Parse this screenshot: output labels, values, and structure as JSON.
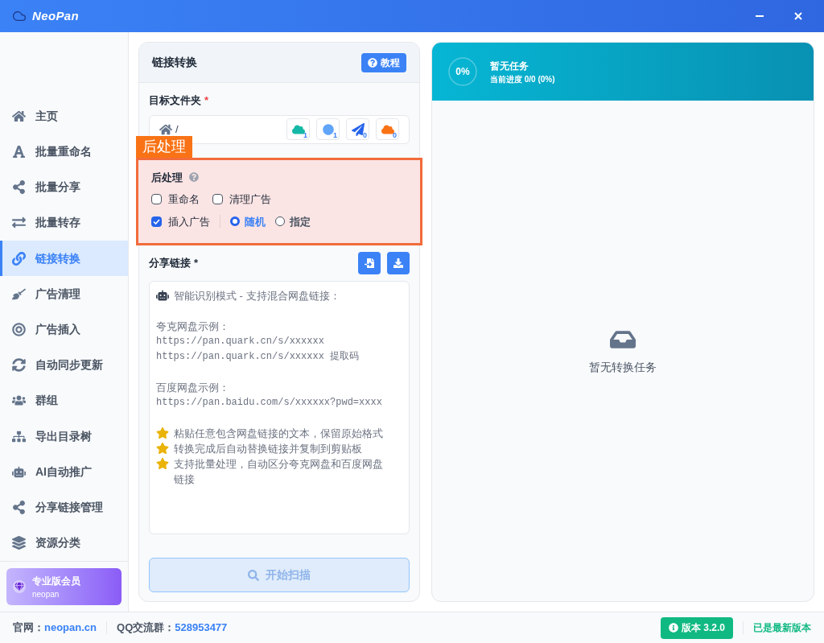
{
  "app": {
    "title": "NeoPan"
  },
  "sidebar": {
    "items": [
      {
        "label": "主页",
        "selected": false
      },
      {
        "label": "批量重命名",
        "selected": false
      },
      {
        "label": "批量分享",
        "selected": false
      },
      {
        "label": "批量转存",
        "selected": false
      },
      {
        "label": "链接转换",
        "selected": true
      },
      {
        "label": "广告清理",
        "selected": false
      },
      {
        "label": "广告插入",
        "selected": false
      },
      {
        "label": "自动同步更新",
        "selected": false
      },
      {
        "label": "群组",
        "selected": false
      },
      {
        "label": "导出目录树",
        "selected": false
      },
      {
        "label": "AI自动推广",
        "selected": false
      },
      {
        "label": "分享链接管理",
        "selected": false
      },
      {
        "label": "资源分类",
        "selected": false
      }
    ],
    "member": {
      "title": "专业版会员",
      "subtitle": "neopan"
    }
  },
  "panel": {
    "title": "链接转换",
    "help_button": "教程",
    "target_label": "目标文件夹",
    "required_mark": "*",
    "path": "/",
    "drives": [
      {
        "count": "1"
      },
      {
        "count": "1"
      },
      {
        "count": "0"
      },
      {
        "count": "0"
      }
    ],
    "annotation": "后处理",
    "post": {
      "title": "后处理",
      "options": [
        {
          "label": "重命名",
          "checked": false
        },
        {
          "label": "清理广告",
          "checked": false
        },
        {
          "label": "插入广告",
          "checked": true
        }
      ],
      "modes": [
        {
          "label": "随机",
          "selected": true
        },
        {
          "label": "指定",
          "selected": false
        }
      ]
    },
    "share_label": "分享链接",
    "share_required": "*",
    "placeholder_lines": [
      {
        "kind": "title",
        "text": "智能识别模式 - 支持混合网盘链接："
      },
      {
        "kind": "label",
        "text": "夸克网盘示例："
      },
      {
        "kind": "url",
        "text": "https://pan.quark.cn/s/xxxxxx"
      },
      {
        "kind": "url",
        "text": "https://pan.quark.cn/s/xxxxxx 提取码"
      },
      {
        "kind": "label",
        "text": "百度网盘示例："
      },
      {
        "kind": "url",
        "text": "https://pan.baidu.com/s/xxxxxx?pwd=xxxx"
      },
      {
        "kind": "tip",
        "text": "粘贴任意包含网盘链接的文本，保留原始格式"
      },
      {
        "kind": "tip",
        "text": "转换完成后自动替换链接并复制到剪贴板"
      },
      {
        "kind": "tip",
        "text": "支持批量处理，自动区分夸克网盘和百度网盘链接"
      }
    ],
    "scan_button": "开始扫描"
  },
  "progress": {
    "level": 0,
    "percent": "0%",
    "title": "暂无任务",
    "detail": "当前进度 0/0 (0%)",
    "empty": "暂无转换任务"
  },
  "footer": {
    "site_label": "官网：",
    "site": "neopan.cn",
    "qq_label": "QQ交流群：",
    "qq": "528953477",
    "version": "版本 3.2.0",
    "status": "已是最新版本"
  }
}
